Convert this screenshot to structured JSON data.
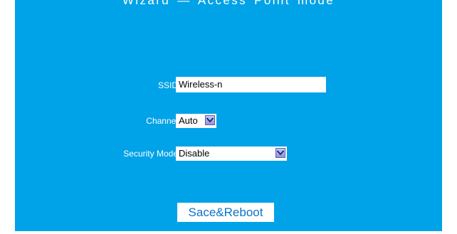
{
  "header": {
    "title": "Wizard  — Access Point  mode"
  },
  "form": {
    "ssid": {
      "label": "SSID",
      "value": "Wireless-n"
    },
    "channel": {
      "label": "Channel",
      "selected": "Auto"
    },
    "security_mode": {
      "label": "Security Mode",
      "selected": "Disable"
    }
  },
  "actions": {
    "save_label": "Sace&Reboot"
  },
  "colors": {
    "panel_background": "#00a2e8",
    "text": "#ffffff",
    "button_text": "#0a74c8",
    "dropdown_arrow": "#8e96d8"
  },
  "icons": {
    "dropdown": "chevron-down-icon"
  }
}
